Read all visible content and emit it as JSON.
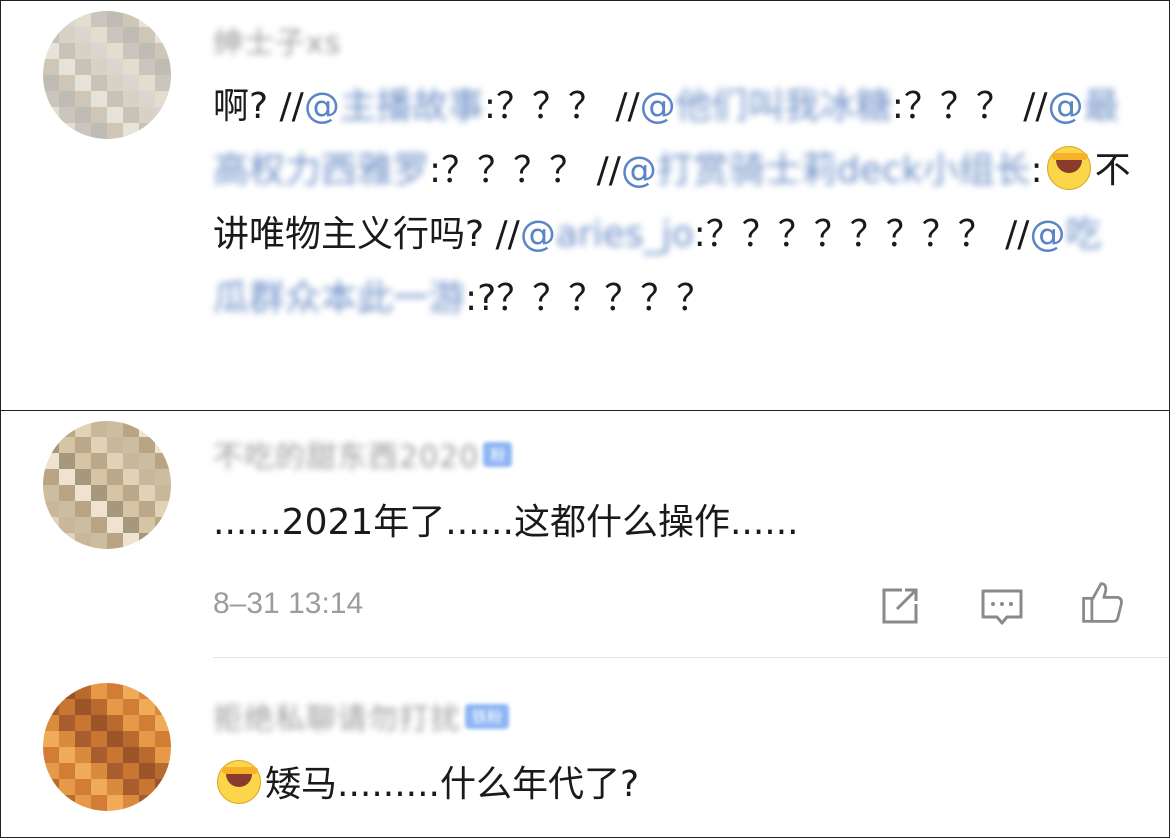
{
  "comments": [
    {
      "username": "绅士子xs",
      "content": {
        "lead": "啊? //",
        "parts": [
          {
            "type": "mention",
            "at": "@",
            "name": "主播故事"
          },
          {
            "type": "text",
            "text": ":？？？ //"
          },
          {
            "type": "mention",
            "at": "@",
            "name": "他们叫我冰糖"
          },
          {
            "type": "text",
            "text": ":？？？ //"
          },
          {
            "type": "mention",
            "at": "@",
            "name": "最高权力西雅罗"
          },
          {
            "type": "text",
            "text": ":？？？？ //"
          },
          {
            "type": "mention",
            "at": "@",
            "name": "打赏骑士莉deck小组长"
          },
          {
            "type": "text",
            "text": ":"
          },
          {
            "type": "emoji",
            "name": "facepalm-laugh-emoji"
          },
          {
            "type": "text",
            "text": "不讲唯物主义行吗? //"
          },
          {
            "type": "mention",
            "at": "@",
            "name": "aries_jo"
          },
          {
            "type": "text",
            "text": ":？？？？？？？？ //"
          },
          {
            "type": "mention",
            "at": "@",
            "name": "吃瓜群众本此一游"
          },
          {
            "type": "text",
            "text": ":?？？？？？？"
          }
        ]
      },
      "avatar_colors": [
        "#d8d2c4",
        "#cfc6b5",
        "#e4ddcd",
        "#c7c3b8",
        "#bfbcb4",
        "#d9d6cf",
        "#e6e3db",
        "#cac6bd"
      ]
    },
    {
      "username": "不吃的甜东西2020",
      "badge": "粉",
      "content_text": "......2021年了......这都什么操作......",
      "time": "8–31 13:14",
      "avatar_colors": [
        "#c9b79a",
        "#d6c4a3",
        "#b9a584",
        "#e0d2b8",
        "#a7977d",
        "#cdbd9f",
        "#bca889",
        "#efe3cf"
      ]
    },
    {
      "username": "拒绝私聊请勿打扰",
      "badge": "铁粉",
      "content_suffix": "矮马.........什么年代了?",
      "avatar_colors": [
        "#d98a3c",
        "#e69a48",
        "#c97632",
        "#f0aa58",
        "#b86a2f",
        "#a85e2c",
        "#d27d36",
        "#9b5528"
      ]
    }
  ],
  "actions": [
    {
      "name": "share-icon",
      "label": "share"
    },
    {
      "name": "comment-icon",
      "label": "comment"
    },
    {
      "name": "like-icon",
      "label": "like"
    }
  ]
}
